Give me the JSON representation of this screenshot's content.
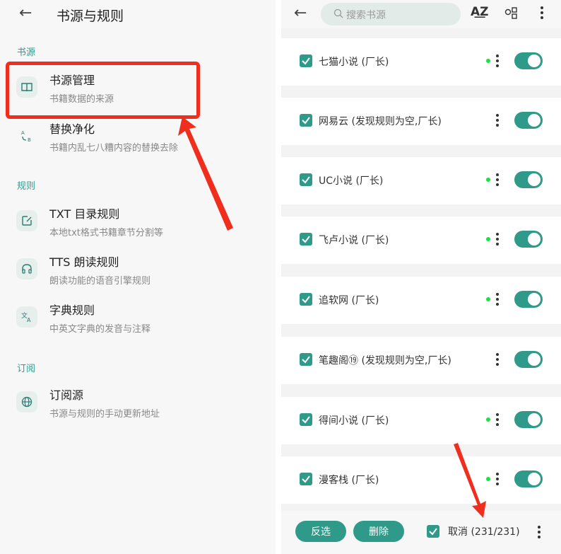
{
  "left": {
    "title": "书源与规则",
    "sections": [
      {
        "label": "书源"
      },
      {
        "label": "规则"
      },
      {
        "label": "订阅"
      }
    ],
    "items": [
      {
        "title": "书源管理",
        "subtitle": "书籍数据的来源",
        "icon": "book-icon"
      },
      {
        "title": "替换净化",
        "subtitle": "书籍内乱七八糟内容的替换去除",
        "icon": "replace-icon"
      },
      {
        "title": "TXT 目录规则",
        "subtitle": "本地txt格式书籍章节分割等",
        "icon": "edit-icon"
      },
      {
        "title": "TTS 朗读规则",
        "subtitle": "朗读功能的语音引擎规则",
        "icon": "headphones-icon"
      },
      {
        "title": "字典规则",
        "subtitle": "中英文字典的发音与注释",
        "icon": "translate-icon"
      },
      {
        "title": "订阅源",
        "subtitle": "书源与规则的手动更新地址",
        "icon": "globe-icon"
      }
    ]
  },
  "right": {
    "search_placeholder": "搜索书源",
    "sources": [
      {
        "name": "七猫小说 (厂长)",
        "checked": true,
        "online": true,
        "enabled": true
      },
      {
        "name": "网易云 (发现规则为空,厂长)",
        "checked": true,
        "online": false,
        "enabled": true
      },
      {
        "name": "UC小说 (厂长)",
        "checked": true,
        "online": true,
        "enabled": true
      },
      {
        "name": "飞卢小说 (厂长)",
        "checked": true,
        "online": true,
        "enabled": true
      },
      {
        "name": "追软网 (厂长)",
        "checked": true,
        "online": true,
        "enabled": true
      },
      {
        "name": "笔趣阁⑲ (发现规则为空,厂长)",
        "checked": true,
        "online": false,
        "enabled": true
      },
      {
        "name": "得间小说 (厂长)",
        "checked": true,
        "online": true,
        "enabled": true
      },
      {
        "name": "漫客栈 (厂长)",
        "checked": true,
        "online": true,
        "enabled": true
      }
    ],
    "bottom": {
      "invert_label": "反选",
      "delete_label": "删除",
      "cancel_label": "取消 (231/231)"
    }
  },
  "colors": {
    "accent": "#2f9a8a",
    "highlight": "#f02e1e",
    "online_dot": "#19e340"
  }
}
